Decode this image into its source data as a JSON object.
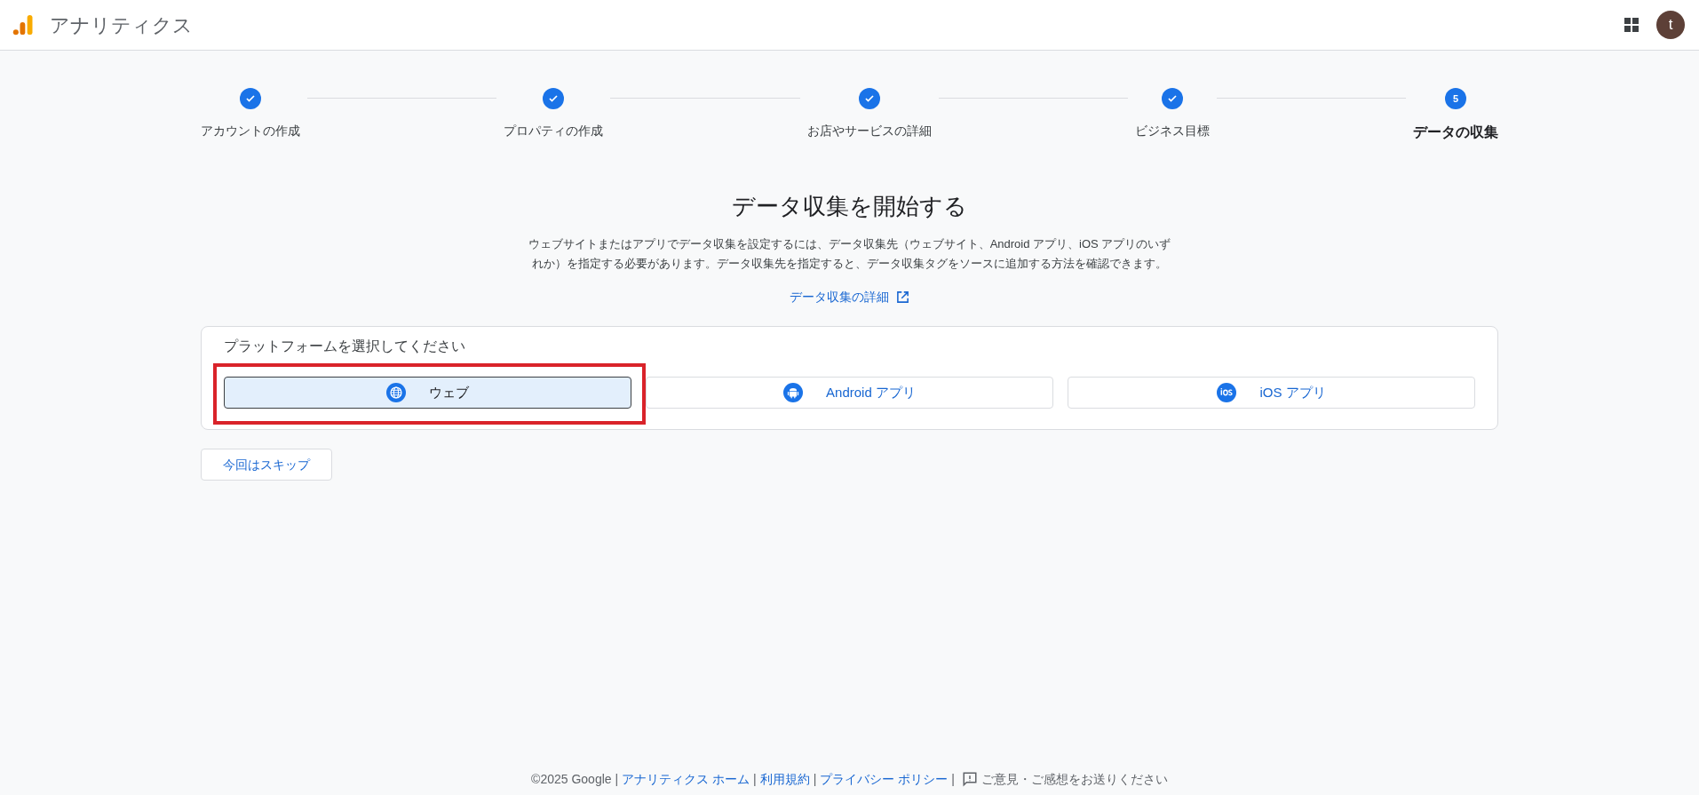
{
  "header": {
    "title": "アナリティクス",
    "avatar": "t"
  },
  "steps": [
    {
      "label": "アカウントの作成",
      "completed": true
    },
    {
      "label": "プロパティの作成",
      "completed": true
    },
    {
      "label": "お店やサービスの詳細",
      "completed": true
    },
    {
      "label": "ビジネス目標",
      "completed": true
    },
    {
      "label": "データの収集",
      "completed": false,
      "number": "5"
    }
  ],
  "heading": "データ収集を開始する",
  "description": "ウェブサイトまたはアプリでデータ収集を設定するには、データ収集先（ウェブサイト、Android アプリ、iOS アプリのいずれか）を指定する必要があります。データ収集先を指定すると、データ収集タグをソースに追加する方法を確認できます。",
  "learn_more": "データ収集の詳細",
  "platform_card": {
    "label": "プラットフォームを選択してください",
    "platforms": [
      {
        "label": "ウェブ",
        "kind": "web",
        "selected": true,
        "highlighted": true
      },
      {
        "label": "Android アプリ",
        "kind": "android",
        "selected": false,
        "highlighted": false
      },
      {
        "label": "iOS アプリ",
        "kind": "ios",
        "selected": false,
        "highlighted": false
      }
    ]
  },
  "skip_button": "今回はスキップ",
  "footer": {
    "separator": "|",
    "copyright": "©2025 Google",
    "links": [
      "アナリティクス ホーム",
      "利用規約",
      "プライバシー ポリシー"
    ],
    "feedback": "ご意見・ご感想をお送りください"
  }
}
